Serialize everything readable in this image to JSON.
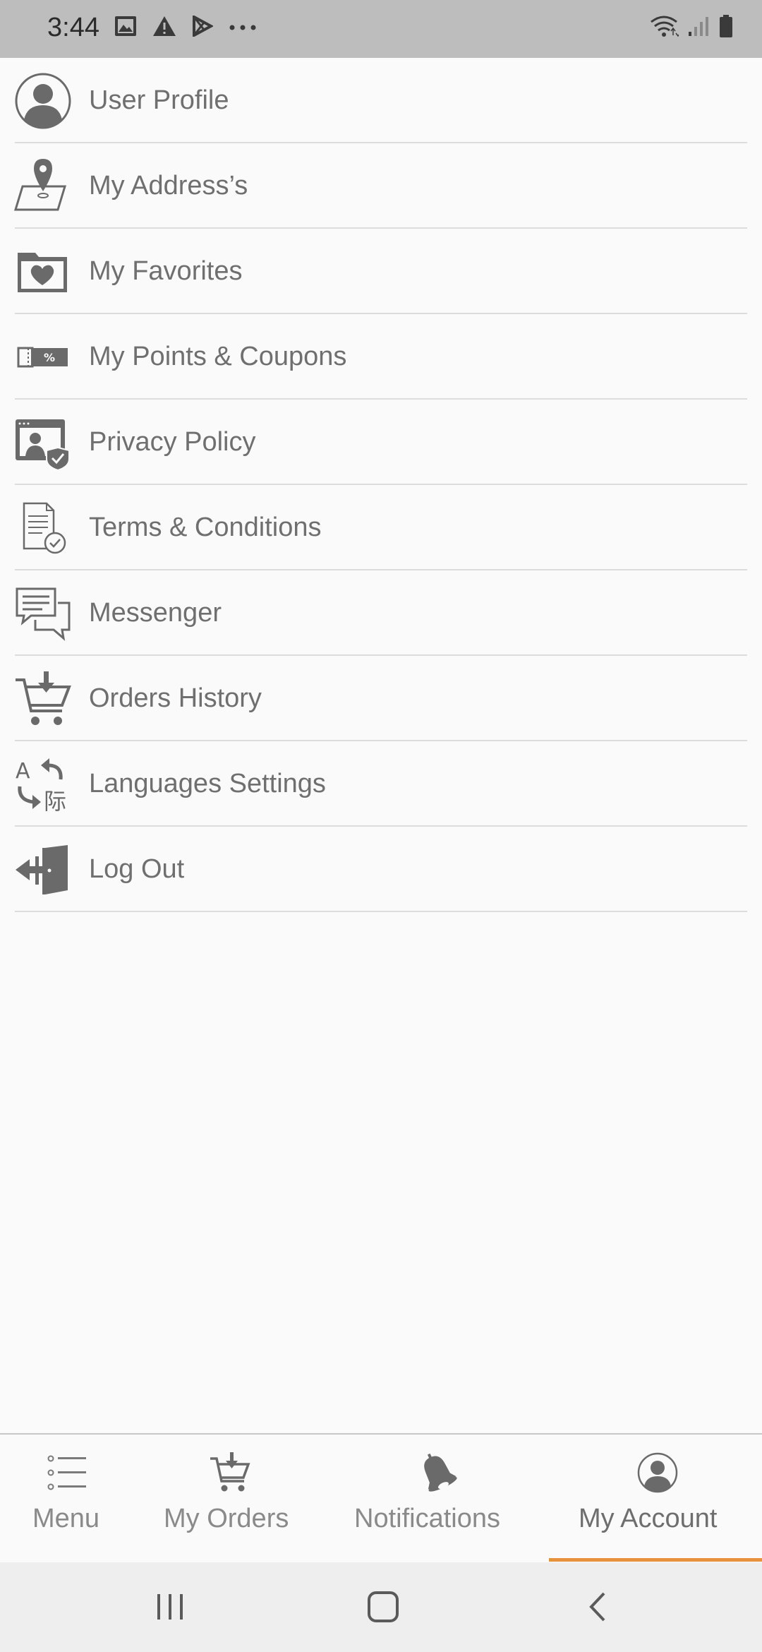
{
  "status_bar": {
    "time": "3:44",
    "left_icons": [
      "image-icon",
      "warning-icon",
      "play-store-icon",
      "more-dots-icon"
    ],
    "right_icons": [
      "wifi-icon",
      "signal-icon",
      "battery-icon"
    ]
  },
  "menu": {
    "items": [
      {
        "label": "User Profile",
        "icon": "user-profile-icon"
      },
      {
        "label": "My Address’s",
        "icon": "map-pin-icon"
      },
      {
        "label": "My Favorites",
        "icon": "heart-folder-icon"
      },
      {
        "label": "My Points & Coupons",
        "icon": "coupon-icon"
      },
      {
        "label": "Privacy Policy",
        "icon": "privacy-shield-icon"
      },
      {
        "label": "Terms & Conditions",
        "icon": "document-check-icon"
      },
      {
        "label": "Messenger",
        "icon": "chat-bubbles-icon"
      },
      {
        "label": "Orders History",
        "icon": "cart-download-icon"
      },
      {
        "label": "Languages Settings",
        "icon": "translate-icon"
      },
      {
        "label": "Log Out",
        "icon": "logout-door-icon"
      }
    ]
  },
  "bottom_nav": {
    "items": [
      {
        "label": "Menu",
        "icon": "list-icon",
        "active": false
      },
      {
        "label": "My Orders",
        "icon": "cart-icon",
        "active": false
      },
      {
        "label": "Notifications",
        "icon": "bell-icon",
        "active": false
      },
      {
        "label": "My Account",
        "icon": "account-icon",
        "active": true
      }
    ],
    "active_color": "#e8913c"
  },
  "system_nav": {
    "buttons": [
      "recent-apps-icon",
      "home-icon",
      "back-icon"
    ]
  }
}
